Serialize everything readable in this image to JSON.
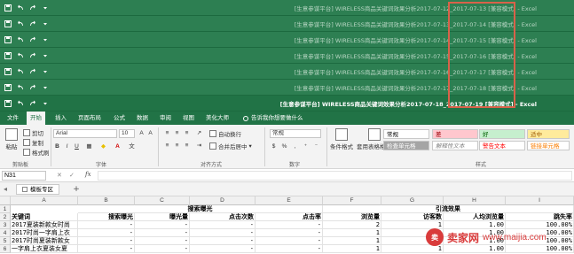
{
  "window_titles": [
    {
      "title": "[生意参谋平台] WIRELESS商品关键词效果分析2017-07-12_2017-07-13 [兼容模式] - Excel",
      "active": false
    },
    {
      "title": "[生意参谋平台] WIRELESS商品关键词效果分析2017-07-13_2017-07-14 [兼容模式] - Excel",
      "active": false
    },
    {
      "title": "[生意参谋平台] WIRELESS商品关键词效果分析2017-07-14_2017-07-15 [兼容模式] - Excel",
      "active": false
    },
    {
      "title": "[生意参谋平台] WIRELESS商品关键词效果分析2017-07-15_2017-07-16 [兼容模式] - Excel",
      "active": false
    },
    {
      "title": "[生意参谋平台] WIRELESS商品关键词效果分析2017-07-16_2017-07-17 [兼容模式] - Excel",
      "active": false
    },
    {
      "title": "[生意参谋平台] WIRELESS商品关键词效果分析2017-07-17_2017-07-18 [兼容模式] - Excel",
      "active": false
    },
    {
      "title": "[生意参谋平台] WIRELESS商品关键词效果分析2017-07-18_2017-07-19 [兼容模式] - Excel",
      "active": true
    }
  ],
  "ribbon": {
    "tabs": [
      "文件",
      "开始",
      "插入",
      "页面布局",
      "公式",
      "数据",
      "审阅",
      "视图",
      "美化大师"
    ],
    "active_tab": "开始",
    "tell_me": "告诉我你想要做什么",
    "clipboard": {
      "paste": "粘贴",
      "cut": "剪切",
      "copy": "复制",
      "format_painter": "格式刷",
      "label": "剪贴板"
    },
    "font": {
      "name": "Arial",
      "size": "10",
      "label": "字体"
    },
    "alignment": {
      "wrap": "自动换行",
      "merge": "合并后居中",
      "label": "对齐方式"
    },
    "number": {
      "format": "常规",
      "label": "数字"
    },
    "styles": {
      "conditional": "条件格式",
      "table": "套用表格格式",
      "cells": [
        {
          "label": "常规",
          "bg": "#ffffff",
          "fg": "#000000"
        },
        {
          "label": "差",
          "bg": "#ffc7ce",
          "fg": "#9c0006"
        },
        {
          "label": "好",
          "bg": "#c6efce",
          "fg": "#006100"
        },
        {
          "label": "适中",
          "bg": "#ffeb9c",
          "fg": "#9c5700"
        },
        {
          "label": "检查单元格",
          "bg": "#a5a5a5",
          "fg": "#ffffff"
        },
        {
          "label": "解释性文本",
          "bg": "#ffffff",
          "fg": "#7f7f7f"
        },
        {
          "label": "警告文本",
          "bg": "#ffffff",
          "fg": "#ff0000"
        },
        {
          "label": "链接单元格",
          "bg": "#ffffff",
          "fg": "#fa7d00"
        }
      ],
      "label": "样式"
    }
  },
  "formula_bar": {
    "name_box": "N31",
    "fx": "fx",
    "value": ""
  },
  "sheet_tab": "模板专区",
  "columns": [
    "A",
    "B",
    "C",
    "D",
    "E",
    "F",
    "G",
    "H",
    "I"
  ],
  "rows": {
    "numbers": [
      "1",
      "2",
      "3",
      "4",
      "5",
      "6"
    ],
    "row1": {
      "d": "搜索曝光",
      "h": "引流效果"
    },
    "row2": [
      "关键词",
      "搜索曝光",
      "曝光量",
      "点击次数",
      "点击率",
      "浏览量",
      "访客数",
      "人均浏览量",
      "跳失率"
    ],
    "row3": [
      "2017夏装新款女时尚",
      "-",
      "-",
      "-",
      "-",
      "2",
      "1",
      "1.00",
      "100.00%"
    ],
    "row4": [
      "2017时尚一字肩上衣",
      "-",
      "-",
      "-",
      "-",
      "1",
      "1",
      "1.00",
      "100.00%"
    ],
    "row5": [
      "2017时尚夏装新款女",
      "-",
      "-",
      "-",
      "-",
      "1",
      "1",
      "1.00",
      "100.00%"
    ],
    "row6": [
      "一字肩上衣夏装女夏",
      "-",
      "-",
      "-",
      "-",
      "1",
      "1",
      "1.00",
      "100.00%"
    ]
  },
  "watermark": {
    "brand": "卖家网",
    "url": "www.maijia.com",
    "logo_text": "卖"
  },
  "colors": {
    "excel_green": "#217346",
    "highlight_red": "#d9624a"
  }
}
